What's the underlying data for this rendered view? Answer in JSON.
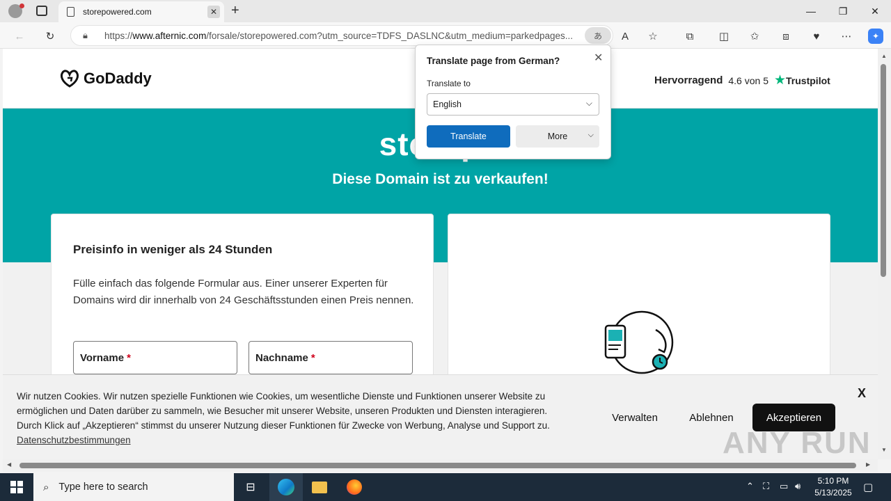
{
  "browser": {
    "tab_title": "storepowered.com",
    "url_prefix": "https://",
    "url_domain": "www.afternic.com",
    "url_rest": "/forsale/storepowered.com?utm_source=TDFS_DASLNC&utm_medium=parkedpages..."
  },
  "header": {
    "logo_text": "GoDaddy",
    "rating_label": "Hervorragend",
    "rating_value": "4.6 von 5",
    "rating_brand": "Trustpilot"
  },
  "hero": {
    "title": "storepo",
    "subtitle": "Diese Domain ist zu verkaufen!"
  },
  "form": {
    "title": "Preisinfo in weniger als 24 Stunden",
    "description": "Fülle einfach das folgende Formular aus. Einer unserer Experten für Domains wird dir innerhalb von 24 Geschäftsstunden einen Preis nennen.",
    "first_name_label": "Vorname",
    "last_name_label": "Nachname",
    "required_mark": "*"
  },
  "translate_popup": {
    "title": "Translate page from German?",
    "translate_to_label": "Translate to",
    "selected_language": "English",
    "translate_button": "Translate",
    "more_button": "More"
  },
  "cookie_banner": {
    "text": "Wir nutzen Cookies. Wir nutzen spezielle Funktionen wie Cookies, um wesentliche Dienste und Funktionen unserer Website zu ermöglichen und Daten darüber zu sammeln, wie Besucher mit unserer Website, unseren Produkten und Diensten interagieren. Durch Klick auf „Akzeptieren“ stimmst du unserer Nutzung dieser Funktionen für Zwecke von Werbung, Analyse und Support zu.",
    "privacy_link": "Datenschutzbestimmungen",
    "manage_button": "Verwalten",
    "reject_button": "Ablehnen",
    "accept_button": "Akzeptieren",
    "close": "X"
  },
  "watermark": "ANY RUN",
  "taskbar": {
    "search_placeholder": "Type here to search",
    "time": "5:10 PM",
    "date": "5/13/2025"
  },
  "colors": {
    "hero": "#00a4a6",
    "translate_blue": "#0f6cbd",
    "taskbar": "#1c2b3a"
  }
}
